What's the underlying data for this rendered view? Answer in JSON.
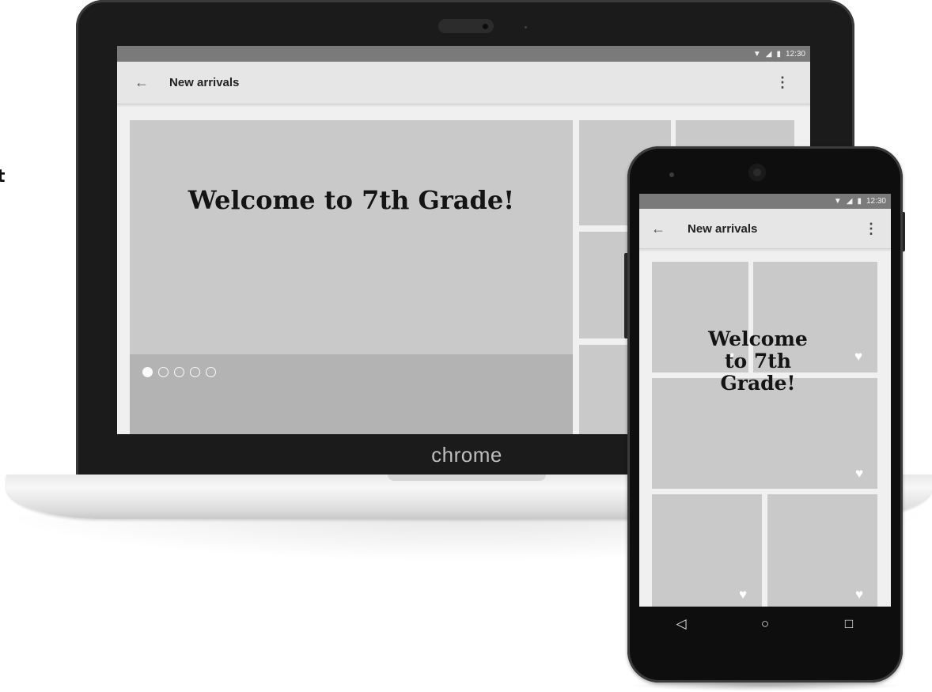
{
  "left_fragment": "t",
  "laptop": {
    "brand": "chrome",
    "status_time": "12:30",
    "toolbar": {
      "back_icon": "←",
      "title": "New arrivals",
      "menu_icon": "⋮"
    },
    "hero": {
      "title": "Welcome to 7th Grade!",
      "slides": 5,
      "active_slide": 1
    }
  },
  "phone": {
    "status_time": "12:30",
    "toolbar": {
      "back_icon": "←",
      "title": "New arrivals",
      "menu_icon": "⋮"
    },
    "hero": {
      "title_line1": "Welcome",
      "title_line2": "to 7th",
      "title_line3": "Grade!"
    },
    "nav": {
      "back_icon": "◁",
      "home_icon": "○",
      "recents_icon": "□"
    }
  },
  "icons": {
    "wifi": "▼",
    "signal": "◢",
    "battery": "▮",
    "heart": "♥"
  },
  "colors": {
    "status_bar": "#7a7a7a",
    "toolbar": "#e6e6e6",
    "tile": "#c9c9c9",
    "hero_footer": "#b3b3b3",
    "device_body": "#1b1b1b"
  }
}
